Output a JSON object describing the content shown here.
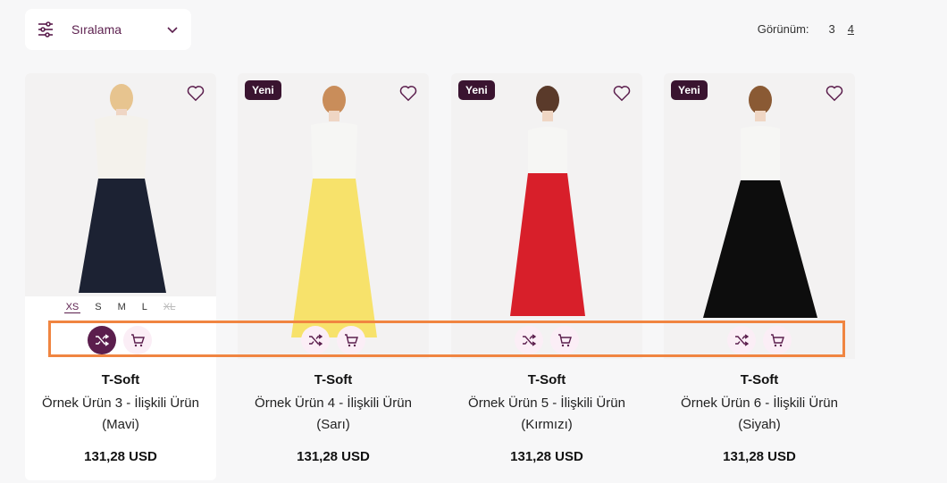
{
  "toolbar": {
    "sort_label": "Sıralama",
    "filter_icon": "filter-sliders-icon",
    "chevron_icon": "chevron-down-icon",
    "view_label": "Görünüm:",
    "view_options": [
      "3",
      "4"
    ],
    "active_view": "4"
  },
  "colors": {
    "accent": "#5b1e4d",
    "badge_bg": "#3a1430",
    "action_bg": "#fbeef6",
    "highlight": "#f08541"
  },
  "products": [
    {
      "badge": "",
      "brand": "T-Soft",
      "name_line1": "Örnek Ürün 3 - İlişkili Ürün",
      "name_line2": "(Mavi)",
      "price": "131,28 USD",
      "skirt_color": "#1c2233",
      "sizes": [
        "XS",
        "S",
        "M",
        "L",
        "XL"
      ],
      "selected_size": "XS",
      "disabled_size": "XL"
    },
    {
      "badge": "Yeni",
      "brand": "T-Soft",
      "name_line1": "Örnek Ürün 4 - İlişkili Ürün",
      "name_line2": "(Sarı)",
      "price": "131,28 USD",
      "skirt_color": "#f7e26b"
    },
    {
      "badge": "Yeni",
      "brand": "T-Soft",
      "name_line1": "Örnek Ürün 5 - İlişkili Ürün",
      "name_line2": "(Kırmızı)",
      "price": "131,28 USD",
      "skirt_color": "#d81f2a"
    },
    {
      "badge": "Yeni",
      "brand": "T-Soft",
      "name_line1": "Örnek Ürün 6 - İlişkili Ürün",
      "name_line2": "(Siyah)",
      "price": "131,28 USD",
      "skirt_color": "#0d0d0d"
    }
  ]
}
